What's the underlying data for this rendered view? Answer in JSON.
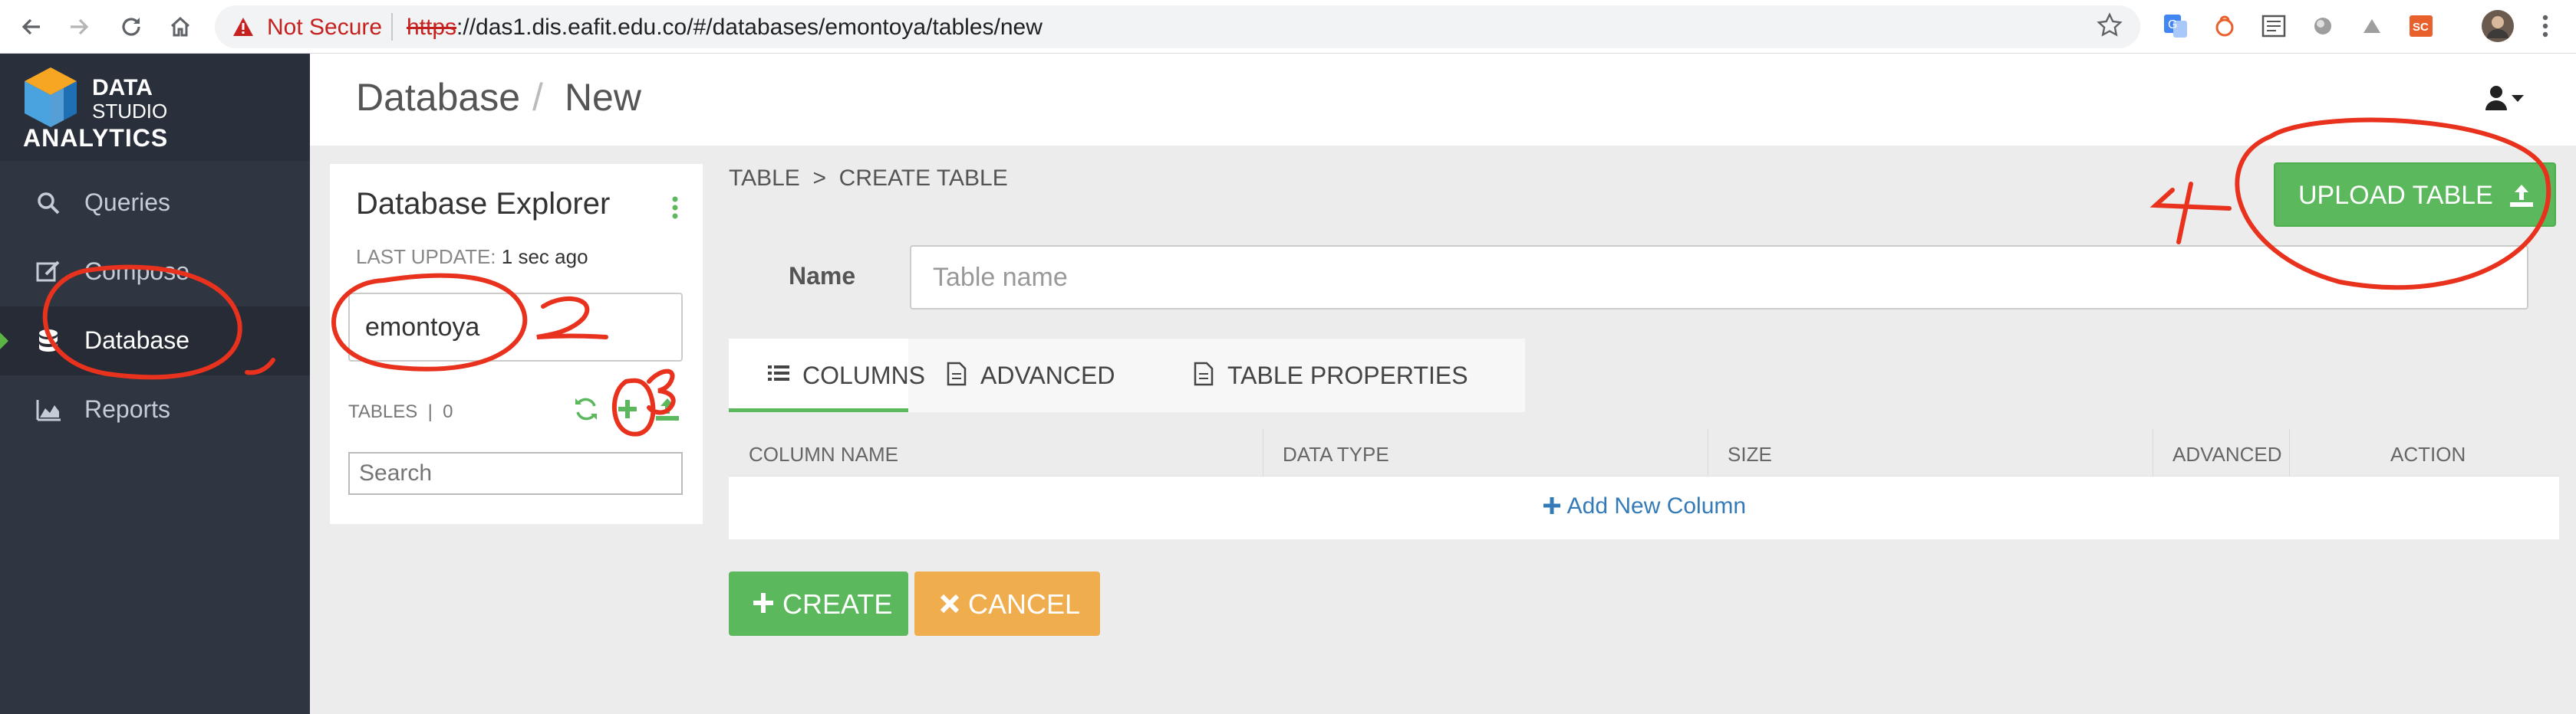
{
  "browser": {
    "security_label": "Not Secure",
    "url_scheme": "https",
    "url_rest": "://das1.dis.eafit.edu.co/#/databases/emontoya/tables/new"
  },
  "sidebar": {
    "logo": {
      "line1": "DATA",
      "line2": "STUDIO",
      "line3": "ANALYTICS"
    },
    "items": [
      {
        "label": "Queries",
        "icon": "search-icon"
      },
      {
        "label": "Compose",
        "icon": "edit-icon"
      },
      {
        "label": "Database",
        "icon": "database-icon",
        "active": true
      },
      {
        "label": "Reports",
        "icon": "area-chart-icon"
      }
    ]
  },
  "header": {
    "section": "Database",
    "page": "New"
  },
  "explorer": {
    "title": "Database Explorer",
    "last_update_label": "LAST UPDATE:",
    "last_update_value": "1 sec ago",
    "database_value": "emontoya",
    "tables_label": "TABLES",
    "tables_count": "0",
    "search_placeholder": "Search"
  },
  "main": {
    "breadcrumb": "TABLE  >  CREATE TABLE",
    "upload_label": "UPLOAD TABLE",
    "name_label": "Name",
    "name_placeholder": "Table name",
    "tabs": [
      {
        "label": "COLUMNS",
        "icon": "list-icon",
        "active": true
      },
      {
        "label": "ADVANCED",
        "icon": "file-icon"
      },
      {
        "label": "TABLE PROPERTIES",
        "icon": "file-icon"
      }
    ],
    "columns": [
      "COLUMN NAME",
      "DATA TYPE",
      "SIZE",
      "ADVANCED",
      "ACTION"
    ],
    "add_column_label": "Add New Column",
    "create_label": "CREATE",
    "cancel_label": "CANCEL"
  },
  "colors": {
    "sidebar_bg": "#2f3541",
    "success": "#5cb85c",
    "warning": "#f0ad4e",
    "link": "#337ab7",
    "annotation": "#e8321e"
  }
}
